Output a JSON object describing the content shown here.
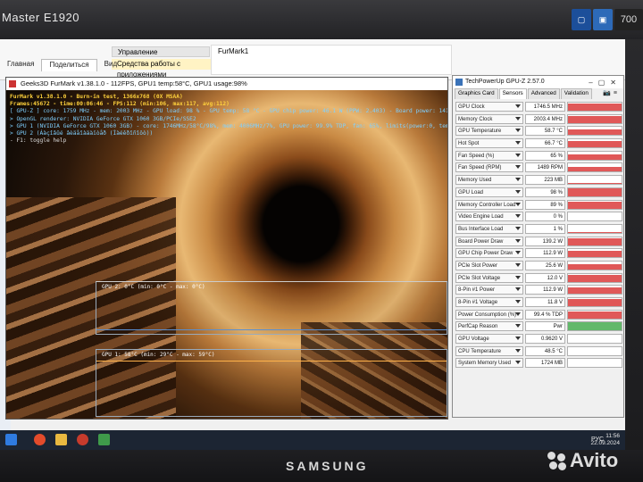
{
  "monitor": {
    "model": "Master E1920",
    "brand": "SAMSUNG",
    "sticker_right": "700",
    "watermark": "Avito"
  },
  "explorer": {
    "tabs": [
      "Главная",
      "Поделиться",
      "Вид"
    ],
    "manage_label": "Управление",
    "tools_label": "Средства работы с приложениями",
    "folder_title": "FurMark1"
  },
  "furmark": {
    "title": "Geeks3D FurMark v1.38.1.0 - 112FPS, GPU1 temp:58°C, GPU1 usage:98%",
    "osd": [
      "FurMark v1.38.1.0 - Burn-in test, 1366x768 (0X MSAA)",
      "Frames:45672 - time:00:06:46 - FPS:112 (min:106, max:117, avg:112)",
      "[ GPU-Z ] core: 1759 MHz - mem: 2003 MHz - GPU load: 98 % - GPU temp: 58 °C - GPU chip power: 46.1 W (PPW: 2.403) - Board power: 141.4 W (PPW: 0.792) - GPU voltage: 0.962 V",
      "> OpenGL renderer: NVIDIA GeForce GTX 1060 3GB/PCIe/SSE2",
      "> GPU 1 (NVIDIA GeForce GTX 1060 3GB) - core: 1746MHz/58°C/98%, mem: 4006MHz/7%, GPU power: 99.9% TDP, fan: 65%, limits(power:0, temp:0, volt:0, OV:0)",
      "> GPU 2 (Áàçîâûé âèäåîàäàïòåð (Ìàéêðîñîôò))",
      "- F1: toggle help"
    ],
    "graph2_label": "GPU 2: 0°C (min: 0°C - max: 0°C)",
    "graph1_label": "GPU 1: 58°C (min: 29°C - max: 59°C)"
  },
  "gpuz": {
    "title": "TechPowerUp GPU-Z 2.57.0",
    "tabs": [
      "Graphics Card",
      "Sensors",
      "Advanced",
      "Validation"
    ],
    "active_tab": "Sensors",
    "sensors": [
      {
        "label": "GPU Clock",
        "value": "1746.5 MHz",
        "level": 0.85
      },
      {
        "label": "Memory Clock",
        "value": "2003.4 MHz",
        "level": 0.85
      },
      {
        "label": "GPU Temperature",
        "value": "58.7 °C",
        "level": 0.75
      },
      {
        "label": "Hot Spot",
        "value": "66.7 °C",
        "level": 0.75
      },
      {
        "label": "Fan Speed (%)",
        "value": "65 %",
        "level": 0.65
      },
      {
        "label": "Fan Speed (RPM)",
        "value": "1489 RPM",
        "level": 0.65
      },
      {
        "label": "Memory Used",
        "value": "223 MB",
        "level": 0.1
      },
      {
        "label": "GPU Load",
        "value": "98 %",
        "level": 0.95
      },
      {
        "label": "Memory Controller Load",
        "value": "89 %",
        "level": 0.85
      },
      {
        "label": "Video Engine Load",
        "value": "0 %",
        "level": 0
      },
      {
        "label": "Bus Interface Load",
        "value": "1 %",
        "level": 0.05
      },
      {
        "label": "Board Power Draw",
        "value": "139.2 W",
        "level": 0.8
      },
      {
        "label": "GPU Chip Power Draw",
        "value": "112.9 W",
        "level": 0.8
      },
      {
        "label": "PCIe Slot Power",
        "value": "25.6 W",
        "level": 0.7
      },
      {
        "label": "PCIe Slot Voltage",
        "value": "12.0 V",
        "level": 0.9
      },
      {
        "label": "8-Pin #1 Power",
        "value": "112.9 W",
        "level": 0.8
      },
      {
        "label": "8-Pin #1 Voltage",
        "value": "11.8 V",
        "level": 0.9
      },
      {
        "label": "Power Consumption (%)",
        "value": "99.4 % TDP",
        "level": 0.9
      },
      {
        "label": "PerfCap Reason",
        "value": "Pwr",
        "level": 1,
        "color": "green"
      },
      {
        "label": "GPU Voltage",
        "value": "0.9620 V",
        "level": 0
      },
      {
        "label": "CPU Temperature",
        "value": "48.5 °C",
        "level": 0
      },
      {
        "label": "System Memory Used",
        "value": "1724 MB",
        "level": 0
      }
    ]
  },
  "taskbar": {
    "time": "11:56",
    "date": "22.09.2024",
    "lang": "РУС"
  },
  "colors": {
    "taskbar": "#1c2533",
    "sensor_bar": "#e05858",
    "perfcap": "#62b86a",
    "osd_title": "#ffd23c",
    "osd_info": "#7fd0ff"
  }
}
